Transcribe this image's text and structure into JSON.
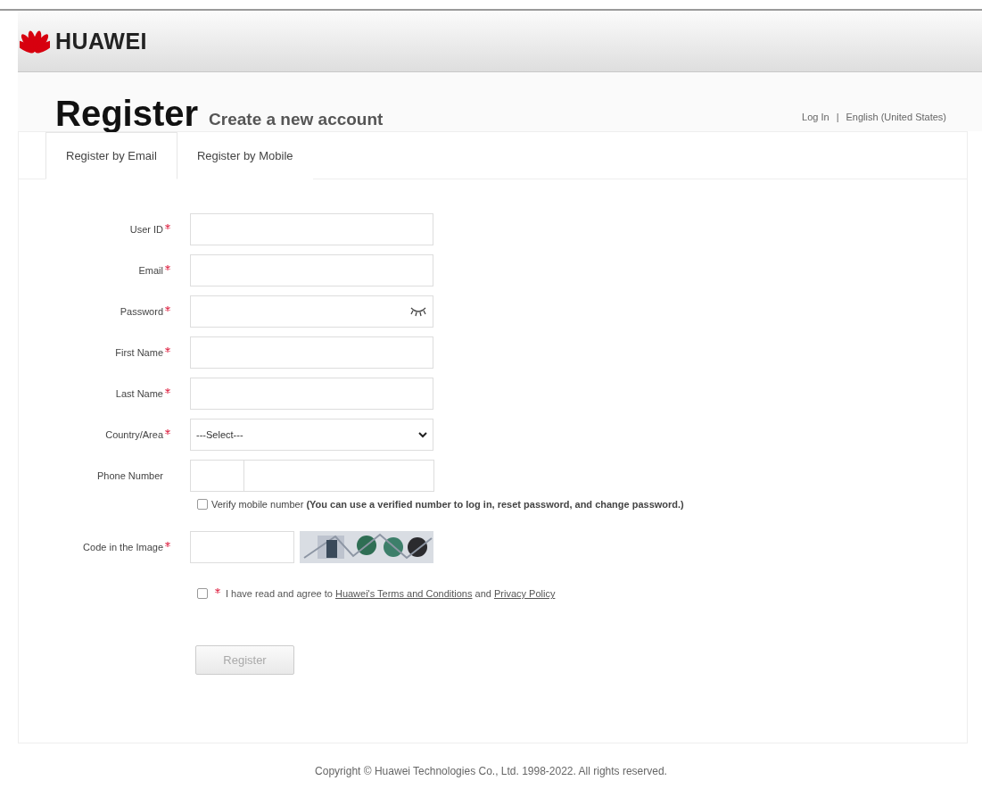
{
  "header": {
    "brand": "HUAWEI"
  },
  "title": {
    "heading": "Register",
    "subtitle": "Create a new account"
  },
  "top_links": [
    {
      "label": "Log In"
    },
    {
      "label": "English (United States)"
    }
  ],
  "top_links_separator": "|",
  "tabs": [
    {
      "label": "Register by Email",
      "selected": true
    },
    {
      "label": "Register by Mobile",
      "selected": false
    }
  ],
  "fields": [
    {
      "label": "User ID",
      "required": true,
      "kind": "text"
    },
    {
      "label": "Email",
      "required": true,
      "kind": "text"
    },
    {
      "label": "Password",
      "required": true,
      "kind": "password"
    },
    {
      "label": "First Name",
      "required": true,
      "kind": "text"
    },
    {
      "label": "Last Name",
      "required": true,
      "kind": "text"
    },
    {
      "label": "Country/Area",
      "required": true,
      "kind": "select",
      "value": "---Select---"
    },
    {
      "label": "Phone Number",
      "required": false,
      "kind": "phone"
    }
  ],
  "verify": {
    "checked": false,
    "text": "Verify mobile number **(You can use a verified number to log in, reset password, and change password.)**"
  },
  "code": {
    "label": "Code in the Image",
    "required": true
  },
  "agree": {
    "checked": false,
    "required": true,
    "before": "I have read and agree to ",
    "link1": "Huawei's Terms and Conditions",
    "middle": " and ",
    "link2": "Privacy Policy"
  },
  "register_button": {
    "label": "Register",
    "disabled": true
  },
  "footer": "Copyright © Huawei Technologies Co., Ltd. 1998-2022. All rights reserved."
}
